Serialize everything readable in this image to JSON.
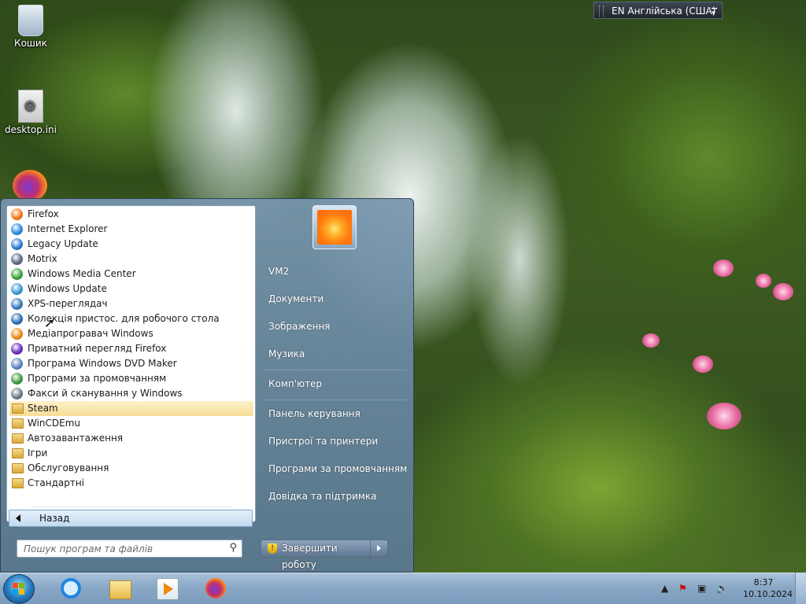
{
  "desktop": {
    "icons": [
      {
        "label": "Кошик"
      },
      {
        "label": "desktop.ini"
      }
    ]
  },
  "language_bar": {
    "label": "EN Англійська (США)"
  },
  "start_menu": {
    "programs": [
      {
        "label": "Firefox",
        "icon": "firefox-icon",
        "color": "#ff7a1a"
      },
      {
        "label": "Internet Explorer",
        "icon": "ie-icon",
        "color": "#2a8be0"
      },
      {
        "label": "Legacy Update",
        "icon": "globe-icon",
        "color": "#2e7bd6"
      },
      {
        "label": "Motrix",
        "icon": "motrix-icon",
        "color": "#5b6b86"
      },
      {
        "label": "Windows Media Center",
        "icon": "media-center-icon",
        "color": "#3aa63a"
      },
      {
        "label": "Windows Update",
        "icon": "windows-update-icon",
        "color": "#3e9ad8"
      },
      {
        "label": "XPS-переглядач",
        "icon": "xps-icon",
        "color": "#3b7bc4"
      },
      {
        "label": "Колекція пристос. для робочого стола",
        "icon": "gadgets-icon",
        "color": "#2e6fb8"
      },
      {
        "label": "Медіапрогравач Windows",
        "icon": "media-player-icon",
        "color": "#f28a16"
      },
      {
        "label": "Приватний перегляд Firefox",
        "icon": "private-browsing-icon",
        "color": "#6b2bbf"
      },
      {
        "label": "Програма Windows DVD Maker",
        "icon": "dvd-maker-icon",
        "color": "#5a88c0"
      },
      {
        "label": "Програми за промовчанням",
        "icon": "default-programs-icon",
        "color": "#3f9a3f"
      },
      {
        "label": "Факси й сканування у Windows",
        "icon": "fax-scan-icon",
        "color": "#6d7a88"
      },
      {
        "label": "Steam",
        "icon": "folder-icon",
        "folder": true,
        "selected": true
      },
      {
        "label": "WinCDEmu",
        "icon": "folder-icon",
        "folder": true
      },
      {
        "label": "Автозавантаження",
        "icon": "folder-icon",
        "folder": true
      },
      {
        "label": "Ігри",
        "icon": "folder-icon",
        "folder": true
      },
      {
        "label": "Обслуговування",
        "icon": "folder-icon",
        "folder": true
      },
      {
        "label": "Стандартні",
        "icon": "folder-icon",
        "folder": true
      }
    ],
    "back_label": "Назад",
    "search_placeholder": "Пошук програм та файлів",
    "right_links": [
      {
        "label": "VM2"
      },
      {
        "label": "Документи"
      },
      {
        "label": "Зображення"
      },
      {
        "label": "Музика"
      },
      {
        "label": "Комп'ютер"
      },
      {
        "label": "Панель керування"
      },
      {
        "label": "Пристрої та принтери"
      },
      {
        "label": "Програми за промовчанням"
      },
      {
        "label": "Довідка та підтримка"
      }
    ],
    "shutdown_label": "Завершити роботу"
  },
  "taskbar": {
    "pinned": [
      {
        "icon": "internet-explorer-icon"
      },
      {
        "icon": "file-explorer-icon"
      },
      {
        "icon": "media-player-icon"
      },
      {
        "icon": "firefox-icon"
      }
    ],
    "time": "8:37",
    "date": "10.10.2024"
  },
  "colors": {
    "selected_row": "#f7dd96",
    "taskbar": "#8aa8c6"
  }
}
